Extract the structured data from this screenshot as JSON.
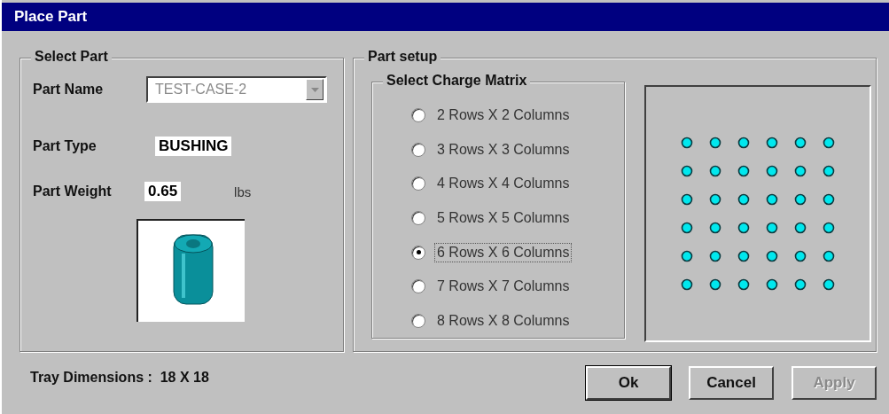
{
  "window": {
    "title": "Place Part"
  },
  "select_part": {
    "title": "Select Part",
    "part_name": {
      "label": "Part Name",
      "value": "TEST-CASE-2",
      "disabled": true
    },
    "part_type": {
      "label": "Part Type",
      "value": "BUSHING"
    },
    "part_weight": {
      "label": "Part Weight",
      "value": "0.65",
      "unit": "lbs"
    }
  },
  "part_setup": {
    "title": "Part setup",
    "charge_matrix": {
      "title": "Select Charge Matrix",
      "options": [
        {
          "label": "2 Rows X 2 Columns",
          "selected": false
        },
        {
          "label": "3 Rows X 3 Columns",
          "selected": false
        },
        {
          "label": "4 Rows X 4 Columns",
          "selected": false
        },
        {
          "label": "5 Rows X 5 Columns",
          "selected": false
        },
        {
          "label": "6 Rows X 6 Columns",
          "selected": true
        },
        {
          "label": "7 Rows X 7 Columns",
          "selected": false
        },
        {
          "label": "8 Rows X 8 Columns",
          "selected": false
        }
      ]
    }
  },
  "tray_dimensions": "Tray Dimensions :  18 X 18",
  "buttons": [
    {
      "label": "Ok",
      "disabled": false,
      "default": true
    },
    {
      "label": "Cancel",
      "disabled": false,
      "default": false
    },
    {
      "label": "Apply",
      "disabled": true,
      "default": false
    }
  ]
}
